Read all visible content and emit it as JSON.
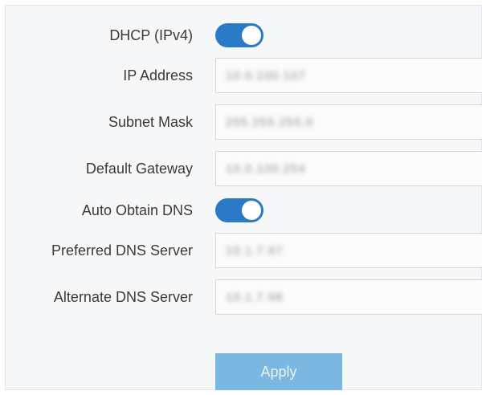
{
  "form": {
    "dhcp": {
      "label": "DHCP (IPv4)",
      "enabled": true
    },
    "ip_address": {
      "label": "IP Address",
      "value": "10.0.100.107"
    },
    "subnet_mask": {
      "label": "Subnet Mask",
      "value": "255.255.255.0"
    },
    "default_gateway": {
      "label": "Default Gateway",
      "value": "10.0.100.254"
    },
    "auto_dns": {
      "label": "Auto Obtain DNS",
      "enabled": true
    },
    "preferred_dns": {
      "label": "Preferred DNS Server",
      "value": "10.1.7.97"
    },
    "alternate_dns": {
      "label": "Alternate DNS Server",
      "value": "10.1.7.98"
    }
  },
  "buttons": {
    "apply_label": "Apply"
  },
  "colors": {
    "toggle_on": "#2a7ac8",
    "apply_disabled": "#7bb7e0",
    "panel_bg": "#f6f7f8"
  }
}
